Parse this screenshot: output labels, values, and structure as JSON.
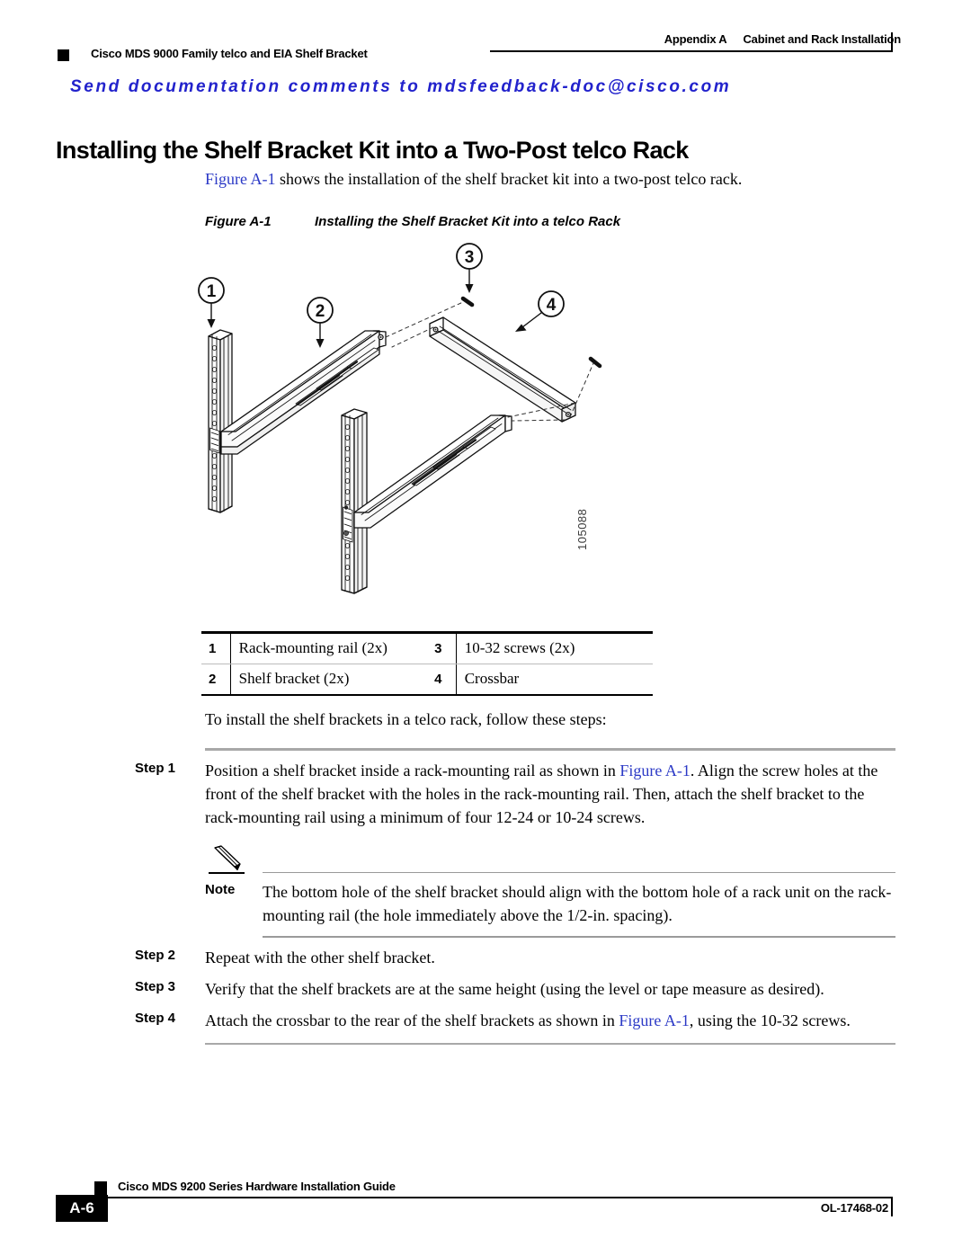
{
  "header": {
    "appendix": "Appendix A",
    "section": "Cabinet and Rack Installation",
    "book_section": "Cisco MDS 9000 Family telco and EIA Shelf Bracket",
    "banner": "Send documentation comments to mdsfeedback-doc@cisco.com",
    "banner_color": "#2222CC"
  },
  "title": "Installing the Shelf Bracket Kit into a Two-Post telco Rack",
  "intro": {
    "xref": "Figure A-1",
    "rest": " shows the installation of the shelf bracket kit into a two-post telco rack."
  },
  "figure": {
    "caption_number": "Figure A-1",
    "caption_title": "Installing the Shelf Bracket Kit into a telco Rack",
    "graphic_id": "105088",
    "callouts": [
      "1",
      "2",
      "3",
      "4"
    ],
    "legend": {
      "rows": [
        {
          "n1": "1",
          "l1": "Rack-mounting rail (2x)",
          "n2": "3",
          "l2": "10-32 screws (2x)"
        },
        {
          "n1": "2",
          "l1": "Shelf bracket (2x)",
          "n2": "4",
          "l2": "Crossbar"
        }
      ]
    }
  },
  "procedure": {
    "leadin": "To install the shelf brackets in a telco rack, follow these steps:",
    "steps": [
      {
        "label": "Step 1",
        "pre": "Position a shelf bracket inside a rack-mounting rail as shown in ",
        "xref": "Figure A-1",
        "post": ". Align the screw holes at the front of the shelf bracket with the holes in the rack-mounting rail. Then, attach the shelf bracket to the rack-mounting rail using a minimum of four 12-24 or 10-24 screws."
      },
      {
        "label": "Step 2",
        "pre": "Repeat with the other shelf bracket.",
        "xref": "",
        "post": ""
      },
      {
        "label": "Step 3",
        "pre": "Verify that the shelf brackets are at the same height (using the level or tape measure as desired).",
        "xref": "",
        "post": ""
      },
      {
        "label": "Step 4",
        "pre": "Attach the crossbar to the rear of the shelf brackets as shown in ",
        "xref": "Figure A-1",
        "post": ", using the 10-32 screws."
      }
    ],
    "note": {
      "label": "Note",
      "text": "The bottom hole of the shelf bracket should align with the bottom hole of a rack unit on the rack-mounting rail (the hole immediately above the 1/2-in. spacing)."
    }
  },
  "footer": {
    "book_title": "Cisco MDS 9200 Series Hardware Installation Guide",
    "page_number": "A-6",
    "doc_id": "OL-17468-02"
  }
}
